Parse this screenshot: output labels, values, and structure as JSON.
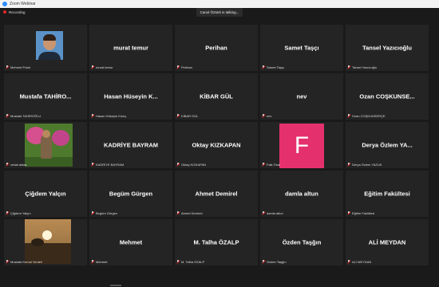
{
  "window": {
    "title": "Zoom Webinar"
  },
  "recording": {
    "label": "Recording"
  },
  "speaking_banner": "Canol Öztürk is talking...",
  "accent_colors": {
    "muted_icon": "#e02828",
    "avatar_f": "#e5306e",
    "recording_dot": "#e02828"
  },
  "participants": [
    {
      "display": "",
      "footer": "Mehmet Polat",
      "type": "photo1"
    },
    {
      "display": "murat temur",
      "footer": "murat temur",
      "type": "text"
    },
    {
      "display": "Perihan",
      "footer": "Perihan",
      "type": "text"
    },
    {
      "display": "Samet Taşçı",
      "footer": "Samet Taşçı",
      "type": "text"
    },
    {
      "display": "Tansel Yazıcıoğlu",
      "footer": "Tansel Yazıcıoğlu",
      "type": "text"
    },
    {
      "display": "Mustafa  TAHİRO...",
      "footer": "Mustafa TAHİROĞLU",
      "type": "text"
    },
    {
      "display": "Hasan Hüseyin K...",
      "footer": "Hasan Hüseyin Kılınç",
      "type": "text"
    },
    {
      "display": "KİBAR GÜL",
      "footer": "KİBAR GÜL",
      "type": "text"
    },
    {
      "display": "nev",
      "footer": "nev",
      "type": "text"
    },
    {
      "display": "Ozan  COŞKUNSE...",
      "footer": "Ozan COŞKUNSERÇE",
      "type": "text"
    },
    {
      "display": "",
      "footer": "vedat aktaş",
      "type": "photo2"
    },
    {
      "display": "KADRİYE BAYRAM",
      "footer": "KADRİYE BAYRAM",
      "type": "text"
    },
    {
      "display": "Oktay KIZKAPAN",
      "footer": "Oktay KIZKAPAN",
      "type": "text"
    },
    {
      "display": "F",
      "footer": "Faik Önal",
      "type": "avatar"
    },
    {
      "display": "Derya Özlem YA...",
      "footer": "Derya Özlem YAZUK",
      "type": "text"
    },
    {
      "display": "Çiğdem Yalçın",
      "footer": "Çiğdem Yalçın",
      "type": "text"
    },
    {
      "display": "Begüm Gürgen",
      "footer": "Begüm Gürgen",
      "type": "text"
    },
    {
      "display": "Ahmet Demirel",
      "footer": "Ahmet Demirel",
      "type": "text"
    },
    {
      "display": "damla altun",
      "footer": "damla altun",
      "type": "text"
    },
    {
      "display": "Eğitim Fakültesi",
      "footer": "Eğitim Fakültesi",
      "type": "text"
    },
    {
      "display": "",
      "footer": "Mustafa Kemal Yerdeli",
      "type": "photo3"
    },
    {
      "display": "Mehmet",
      "footer": "Mehmet",
      "type": "text"
    },
    {
      "display": "M. Talha ÖZALP",
      "footer": "M. Talha ÖZALP",
      "type": "text"
    },
    {
      "display": "Özden Taşğın",
      "footer": "Özden Taşğın",
      "type": "text"
    },
    {
      "display": "ALİ MEYDAN",
      "footer": "ALİ MEYDAN",
      "type": "text"
    }
  ]
}
